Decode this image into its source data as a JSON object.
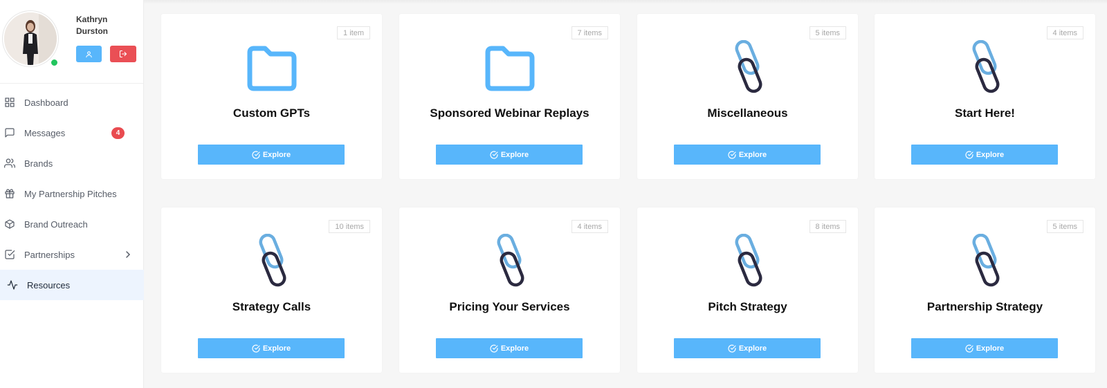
{
  "user": {
    "name": "Kathryn Durston",
    "profile_button_icon": "user-icon",
    "logout_button_icon": "logout-icon"
  },
  "sidebar": {
    "items": [
      {
        "label": "Dashboard",
        "icon": "grid-icon"
      },
      {
        "label": "Messages",
        "icon": "message-icon",
        "badge": "4"
      },
      {
        "label": "Brands",
        "icon": "users-icon"
      },
      {
        "label": "My Partnership Pitches",
        "icon": "gift-icon"
      },
      {
        "label": "Brand Outreach",
        "icon": "box-icon"
      },
      {
        "label": "Partnerships",
        "icon": "check-square-icon",
        "has_submenu": true
      },
      {
        "label": "Resources",
        "icon": "activity-icon",
        "active": true
      }
    ]
  },
  "cards": [
    {
      "title": "Custom GPTs",
      "count": "1 item",
      "icon": "folder-icon",
      "button": "Explore"
    },
    {
      "title": "Sponsored Webinar Replays",
      "count": "7 items",
      "icon": "folder-icon",
      "button": "Explore"
    },
    {
      "title": "Miscellaneous",
      "count": "5 items",
      "icon": "paperclip-icon",
      "button": "Explore"
    },
    {
      "title": "Start Here!",
      "count": "4 items",
      "icon": "paperclip-icon",
      "button": "Explore"
    },
    {
      "title": "Strategy Calls",
      "count": "10 items",
      "icon": "paperclip-icon",
      "button": "Explore"
    },
    {
      "title": "Pricing Your Services",
      "count": "4 items",
      "icon": "paperclip-icon",
      "button": "Explore"
    },
    {
      "title": "Pitch Strategy",
      "count": "8 items",
      "icon": "paperclip-icon",
      "button": "Explore"
    },
    {
      "title": "Partnership Strategy",
      "count": "5 items",
      "icon": "paperclip-icon",
      "button": "Explore"
    }
  ],
  "colors": {
    "accent": "#58b6fb",
    "danger": "#ea4f55",
    "online": "#22c55e",
    "active_nav_bg": "#edf4fe",
    "clip_light": "#6aaee0",
    "clip_dark": "#2b2a40"
  }
}
